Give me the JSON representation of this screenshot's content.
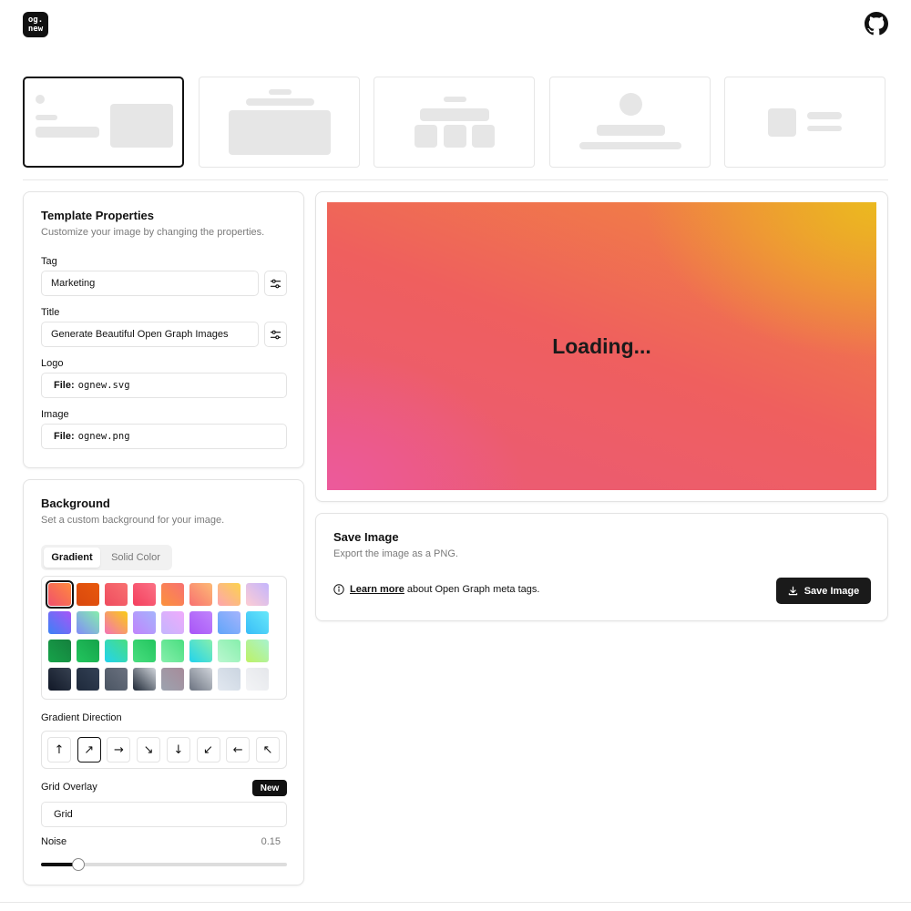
{
  "header": {
    "logo_line1": "og.",
    "logo_line2": "new",
    "github_icon": "github-icon"
  },
  "templates": {
    "selected_index": 0,
    "count": 5
  },
  "properties": {
    "title": "Template Properties",
    "subtitle": "Customize your image by changing the properties.",
    "tag_label": "Tag",
    "tag_value": "Marketing",
    "title_label": "Title",
    "title_value": "Generate Beautiful Open Graph Images",
    "logo_label": "Logo",
    "logo_file_prefix": "File:",
    "logo_file": "ognew.svg",
    "image_label": "Image",
    "image_file_prefix": "File:",
    "image_file": "ognew.png"
  },
  "background": {
    "title": "Background",
    "subtitle": "Set a custom background for your image.",
    "tabs": [
      "Gradient",
      "Solid Color"
    ],
    "active_tab": "Gradient",
    "gradients": [
      [
        "#f0506e",
        "#ff8a3d"
      ],
      [
        "#d9480f",
        "#e8590c"
      ],
      [
        "#ef4c5f",
        "#f87171"
      ],
      [
        "#f43f5e",
        "#fb7185"
      ],
      [
        "#fb923c",
        "#f87171"
      ],
      [
        "#f87171",
        "#fdba74"
      ],
      [
        "#fda4af",
        "#fcd34d"
      ],
      [
        "#fecdd3",
        "#c4b5fd"
      ],
      [
        "#3b82f6",
        "#a855f7"
      ],
      [
        "#818cf8",
        "#86efac"
      ],
      [
        "#f472b6",
        "#facc15"
      ],
      [
        "#c084fc",
        "#a5b4fc"
      ],
      [
        "#c4b5fd",
        "#f0abfc"
      ],
      [
        "#a855f7",
        "#c084fc"
      ],
      [
        "#60a5fa",
        "#a5b4fc"
      ],
      [
        "#38bdf8",
        "#67e8f9"
      ],
      [
        "#16a34a",
        "#15803d"
      ],
      [
        "#22c55e",
        "#16a34a"
      ],
      [
        "#22d3ee",
        "#4ade80"
      ],
      [
        "#4ade80",
        "#22c55e"
      ],
      [
        "#86efac",
        "#4ade80"
      ],
      [
        "#22d3ee",
        "#86efac"
      ],
      [
        "#bbf7d0",
        "#86efac"
      ],
      [
        "#bef264",
        "#a7f3d0"
      ],
      [
        "#111827",
        "#374151"
      ],
      [
        "#1e293b",
        "#334155"
      ],
      [
        "#4b5563",
        "#6b7280"
      ],
      [
        "#1f2937",
        "#d1d5db"
      ],
      [
        "#9ca3af",
        "#a78b9a"
      ],
      [
        "#6b7280",
        "#d1d5db"
      ],
      [
        "#e2e8f0",
        "#cbd5e1"
      ],
      [
        "#f3f4f6",
        "#e5e7eb"
      ]
    ],
    "selected_gradient": 0,
    "direction_label": "Gradient Direction",
    "directions": [
      "↑",
      "↗",
      "→",
      "↘",
      "↓",
      "↙",
      "←",
      "↖"
    ],
    "selected_direction": 1,
    "grid_label": "Grid Overlay",
    "grid_badge": "New",
    "grid_value": "Grid",
    "noise_label": "Noise",
    "noise_value": "0.15",
    "noise_fraction": 0.15
  },
  "preview": {
    "status": "Loading..."
  },
  "save": {
    "title": "Save Image",
    "subtitle": "Export the image as a PNG.",
    "learn_more": "Learn more",
    "info_suffix": "about Open Graph meta tags.",
    "button": "Save Image"
  }
}
